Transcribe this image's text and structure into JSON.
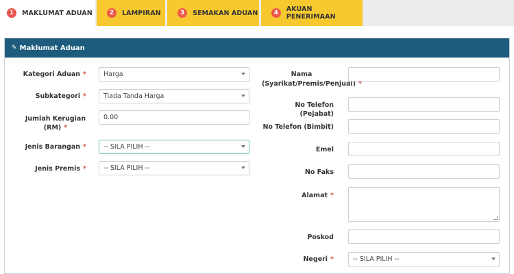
{
  "tabs": [
    {
      "num": "1",
      "label": "MAKLUMAT ADUAN"
    },
    {
      "num": "2",
      "label": "LAMPIRAN"
    },
    {
      "num": "3",
      "label": "SEMAKAN ADUAN"
    },
    {
      "num": "4",
      "label": "AKUAN PENERIMAAN"
    }
  ],
  "panel": {
    "title": "Maklumat Aduan"
  },
  "form_left": {
    "kategori": {
      "label": "Kategori Aduan",
      "value": "Harga"
    },
    "subkategori": {
      "label": "Subkategori",
      "value": "Tiada Tanda Harga"
    },
    "jumlah": {
      "label_line1": "Jumlah Kerugian",
      "label_line2": "(RM)",
      "value": "0.00"
    },
    "jenis_barangan": {
      "label": "Jenis Barangan",
      "value": "-- SILA PILIH --"
    },
    "jenis_premis": {
      "label": "Jenis Premis",
      "value": "-- SILA PILIH --"
    }
  },
  "form_right": {
    "nama": {
      "label_line1": "Nama",
      "label_line2": "(Syarikat/Premis/Penjual)",
      "value": ""
    },
    "tel_pejabat": {
      "label": "No Telefon (Pejabat)",
      "value": ""
    },
    "tel_bimbit": {
      "label": "No Telefon (Bimbit)",
      "value": ""
    },
    "emel": {
      "label": "Emel",
      "value": ""
    },
    "faks": {
      "label": "No Faks",
      "value": ""
    },
    "alamat": {
      "label": "Alamat",
      "value": ""
    },
    "poskod": {
      "label": "Poskod",
      "value": ""
    },
    "negeri": {
      "label": "Negeri",
      "value": "-- SILA PILIH --"
    }
  },
  "required_mark": "*",
  "colors": {
    "tab_pending": "#f7c92e",
    "tab_number": "#ee5a4a",
    "panel_header": "#1d5c7d",
    "required": "#d9534f"
  }
}
